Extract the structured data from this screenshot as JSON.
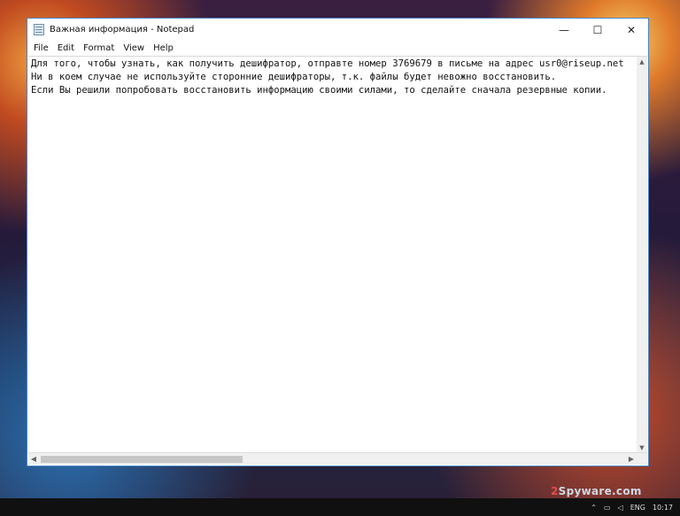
{
  "window": {
    "title": "Важная информация - Notepad",
    "controls": {
      "minimize": "—",
      "maximize": "☐",
      "close": "✕"
    }
  },
  "menu": [
    "File",
    "Edit",
    "Format",
    "View",
    "Help"
  ],
  "content": {
    "lines": [
      "Для того, чтобы узнать, как получить дешифратор, отправте номер 3769679 в письме на адрес usr0@riseup.net",
      "Ни в коем случае не используйте сторонние дешифраторы, т.к. файлы будет невожно восстановить.",
      "Если Вы решили попробовать восстановить информацию своими силами, то сделайте сначала резервные копии."
    ]
  },
  "scrollbars": {
    "up": "▲",
    "down": "▼",
    "left": "◀",
    "right": "▶"
  },
  "watermark": {
    "digit": "2",
    "text": "Spyware.com"
  },
  "taskbar": {
    "language": "ENG",
    "time": "10:17"
  }
}
